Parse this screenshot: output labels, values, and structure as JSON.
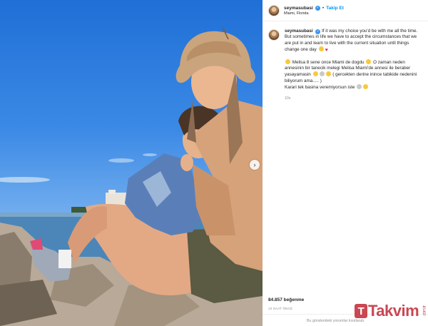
{
  "post": {
    "username": "seymasubasi",
    "follow_label": "Takip Et",
    "separator": "•",
    "location": "Miami, Florida",
    "caption_p1": "If it was my choice you'd be with me all the time. But sometimes in life we have to accept the circumstances that we are put in and learn to live with the current situation until things change one day",
    "caption_p2_a": "Melisa 8 sene once Miami de dogdu",
    "caption_p2_b": "O zaman neden annesinin bir tanecik melegi Melisa Miami'de annesi ile beraber yasayamasin",
    "caption_p2_c": "( gercekten derine inince tabikide nedenini biliyorum ama..... )",
    "caption_p2_d": "Karari tek basina veremiyorsun iste",
    "comment_time": "10s",
    "likes": "84.857 beğenme",
    "posted_ago": "10 SAAT ÖNCE",
    "comments_off": "Bu gönderideki yorumlar kısıtlandı."
  },
  "icons": {
    "verified": "verified-badge-icon",
    "next": "chevron-right-icon",
    "heart": "heart-emoji-icon"
  },
  "colors": {
    "accent": "#0095f6",
    "verified": "#3897f0",
    "muted": "#8e8e8e",
    "watermark": "#be1e2d"
  },
  "watermark": {
    "text": "Takvim",
    "mark": "T",
    "suffix": ".com.tr"
  }
}
